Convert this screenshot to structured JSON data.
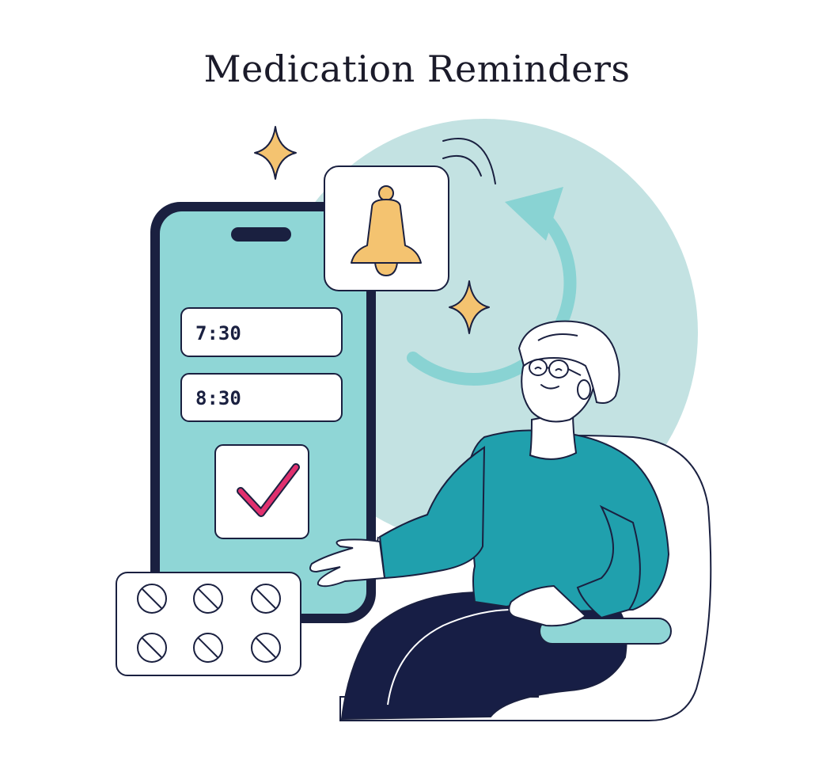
{
  "title": "Medication Reminders",
  "reminders": [
    {
      "time": "7:30"
    },
    {
      "time": "8:30"
    }
  ],
  "icons": {
    "bell": "bell-icon",
    "check": "checkmark-icon",
    "pills": "pill-blister-icon",
    "sparkle": "sparkle-icon",
    "refresh": "circular-arrow-icon"
  },
  "colors": {
    "outline": "#1a2040",
    "phone_screen": "#8fd6d6",
    "background_circle": "#c3e2e2",
    "sweater": "#20a0ad",
    "pants": "#171e45",
    "bell": "#f4c370",
    "check": "#e0306e",
    "arrow": "#89d3d3"
  }
}
